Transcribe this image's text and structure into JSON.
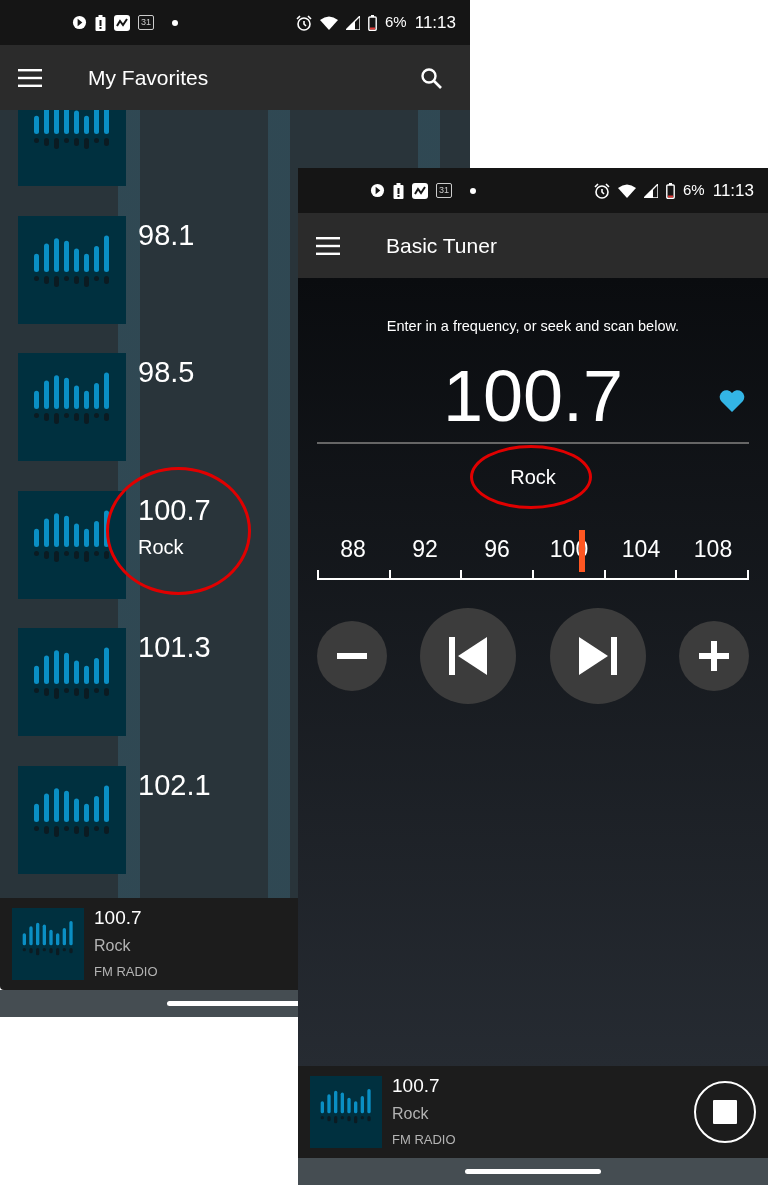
{
  "screens": [
    {
      "status_bar": {
        "calendar_day": "31",
        "battery": "6%",
        "time": "11:13"
      },
      "app_bar": {
        "title": "My Favorites"
      },
      "favorites": [
        {
          "kind": "partial"
        },
        {
          "kind": "station",
          "frequency": "98.1",
          "highlighted": false
        },
        {
          "kind": "station",
          "frequency": "98.5",
          "highlighted": false
        },
        {
          "kind": "station",
          "frequency": "100.7",
          "genre": "Rock",
          "highlighted": true
        },
        {
          "kind": "station",
          "frequency": "101.3",
          "highlighted": false
        },
        {
          "kind": "station",
          "frequency": "102.1",
          "highlighted": false
        }
      ],
      "mini_player": {
        "frequency": "100.7",
        "genre": "Rock",
        "source": "FM RADIO"
      }
    },
    {
      "status_bar": {
        "calendar_day": "31",
        "battery": "6%",
        "time": "11:13"
      },
      "app_bar": {
        "title": "Basic Tuner"
      },
      "tuner": {
        "hint": "Enter in a frequency, or seek and scan below.",
        "frequency": "100.7",
        "favorite": true,
        "genre": "Rock",
        "genre_highlighted": true,
        "scale": [
          "88",
          "92",
          "96",
          "100",
          "104",
          "108"
        ],
        "level": 0.61
      },
      "mini_player": {
        "frequency": "100.7",
        "genre": "Rock",
        "source": "FM RADIO",
        "stop_button": true
      }
    }
  ]
}
